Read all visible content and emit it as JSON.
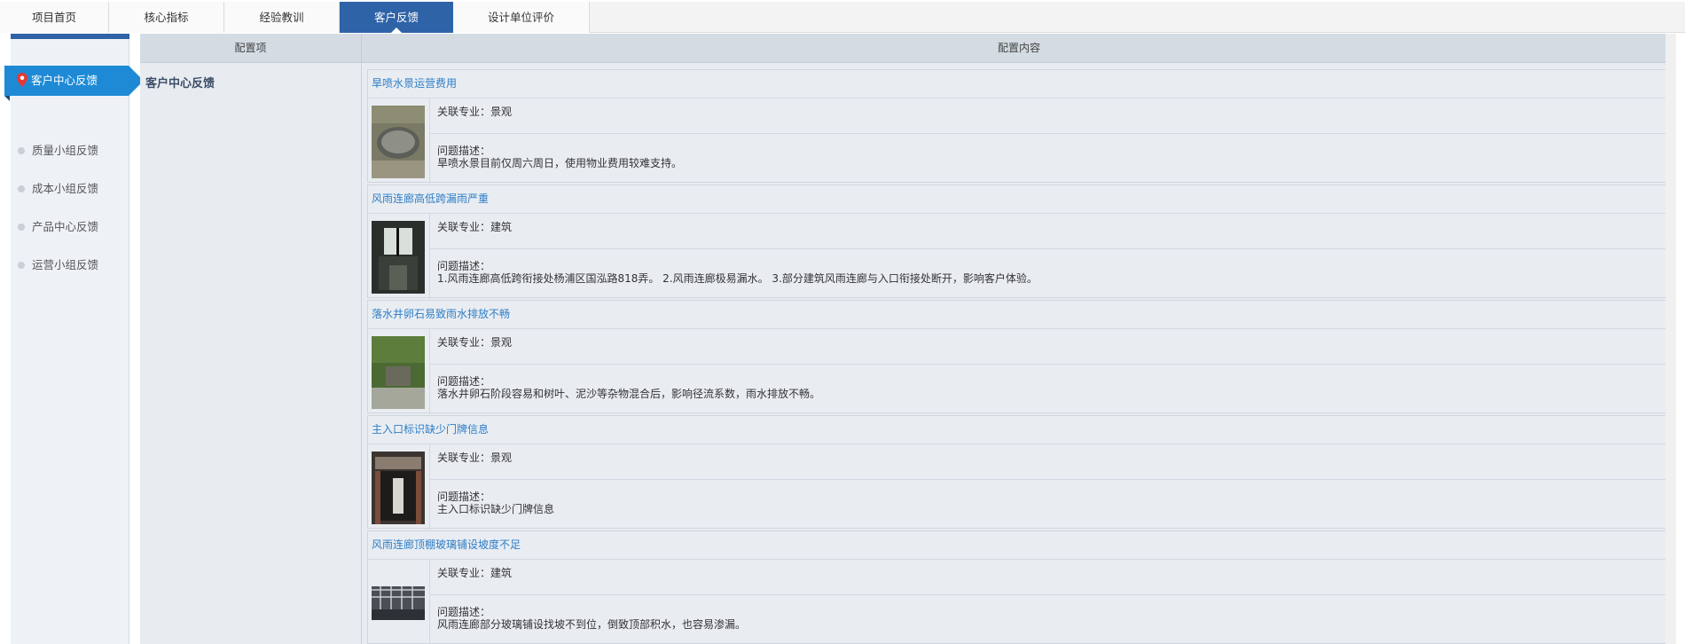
{
  "tabs": [
    {
      "label": "项目首页",
      "active": false
    },
    {
      "label": "核心指标",
      "active": false
    },
    {
      "label": "经验教训",
      "active": false
    },
    {
      "label": "客户反馈",
      "active": true
    },
    {
      "label": "设计单位评价",
      "active": false
    }
  ],
  "sidebar": {
    "active": {
      "label": "客户中心反馈"
    },
    "items": [
      {
        "label": "质量小组反馈"
      },
      {
        "label": "成本小组反馈"
      },
      {
        "label": "产品中心反馈"
      },
      {
        "label": "运营小组反馈"
      }
    ]
  },
  "table": {
    "col1_header": "配置项",
    "col2_header": "配置内容",
    "section_title": "客户中心反馈"
  },
  "issues": [
    {
      "title": "旱喷水景运营费用",
      "specialty": "关联专业：景观",
      "desc_label": "问题描述：",
      "desc": "旱喷水景目前仅周六周日，使用物业费用较难支持。"
    },
    {
      "title": "风雨连廊高低跨漏雨严重",
      "specialty": "关联专业：建筑",
      "desc_label": "问题描述：",
      "desc": "1.风雨连廊高低跨衔接处杨浦区国泓路818弄。 2.风雨连廊极易漏水。 3.部分建筑风雨连廊与入口衔接处断开，影响客户体验。"
    },
    {
      "title": "落水井卵石易致雨水排放不畅",
      "specialty": "关联专业：景观",
      "desc_label": "问题描述：",
      "desc": "落水井卵石阶段容易和树叶、泥沙等杂物混合后，影响径流系数，雨水排放不畅。"
    },
    {
      "title": "主入口标识缺少门牌信息",
      "specialty": "关联专业：景观",
      "desc_label": "问题描述：",
      "desc": "主入口标识缺少门牌信息"
    },
    {
      "title": "风雨连廊顶棚玻璃铺设坡度不足",
      "specialty": "关联专业：建筑",
      "desc_label": "问题描述：",
      "desc": "风雨连廊部分玻璃铺设找坡不到位，倒致顶部积水，也容易渗漏。"
    }
  ]
}
